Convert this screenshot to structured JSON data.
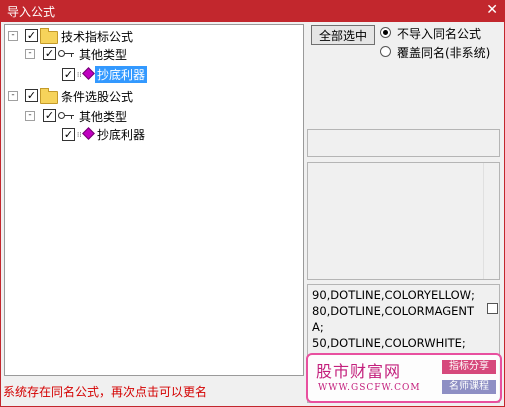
{
  "window": {
    "title": "导入公式",
    "close_glyph": "✕"
  },
  "tree": {
    "nodes": [
      {
        "label": "技术指标公式",
        "checked": true,
        "expander": "-",
        "icon": "folder-icon"
      },
      {
        "label": "其他类型",
        "checked": true,
        "expander": "-",
        "icon": "key-icon"
      },
      {
        "label": "抄底利器",
        "checked": true,
        "selected": true,
        "icon": "gem-icon"
      },
      {
        "label": "条件选股公式",
        "checked": true,
        "expander": "-",
        "icon": "folder-icon"
      },
      {
        "label": "其他类型",
        "checked": true,
        "expander": "-",
        "icon": "key-icon"
      },
      {
        "label": "抄底利器",
        "checked": true,
        "selected": false,
        "icon": "gem-icon"
      }
    ],
    "check_glyph": "✓"
  },
  "actions": {
    "select_all_label": "全部选中"
  },
  "options": {
    "radio1_label": "不导入同名公式",
    "radio1_checked": true,
    "radio2_label": "覆盖同名(非系统)",
    "radio2_checked": false
  },
  "code": {
    "text": "90,DOTLINE,COLORYELLOW;\n80,DOTLINE,COLORMAGENTA;\n50,DOTLINE,COLORWHITE;"
  },
  "status": {
    "text": "系统存在同名公式，再次点击可以更名"
  },
  "watermark": {
    "site_name": "股市财富网",
    "url": "WWW.GSCFW.COM",
    "tag1": "指标分享",
    "tag2": "名师课程",
    "colors": {
      "pink": "#c31f7c",
      "tag1": "#d6497c",
      "tag2": "#8e8fc4"
    }
  },
  "colors": {
    "titlebar": "#c2272d",
    "selection": "#3399ff",
    "status_text": "#d40000"
  }
}
